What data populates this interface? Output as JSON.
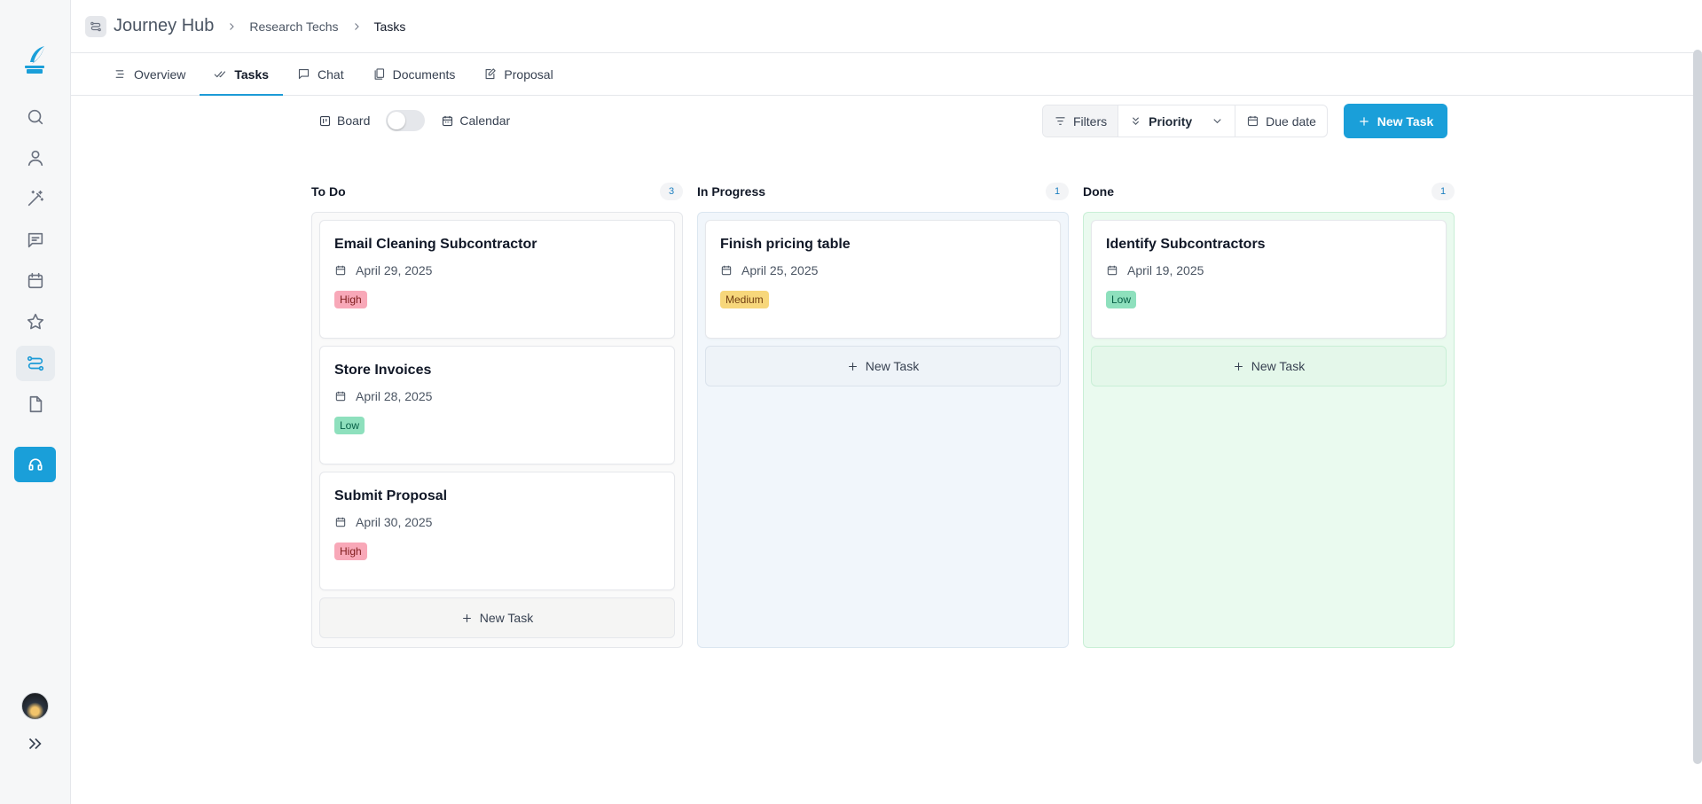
{
  "sidebar": {
    "items": [
      {
        "icon": "search-icon"
      },
      {
        "icon": "user-icon"
      },
      {
        "icon": "magic-wand-icon"
      },
      {
        "icon": "message-icon"
      },
      {
        "icon": "calendar-icon"
      },
      {
        "icon": "star-icon"
      },
      {
        "icon": "route-icon",
        "active": true
      },
      {
        "icon": "file-icon"
      }
    ],
    "support_icon": "headset-icon",
    "accent_color": "#1a9fd9"
  },
  "header": {
    "title": "Journey Hub",
    "breadcrumbs": [
      "Research Techs",
      "Tasks"
    ]
  },
  "tabs": [
    {
      "label": "Overview",
      "icon": "list-icon"
    },
    {
      "label": "Tasks",
      "icon": "check-double-icon",
      "active": true
    },
    {
      "label": "Chat",
      "icon": "chat-icon"
    },
    {
      "label": "Documents",
      "icon": "documents-icon"
    },
    {
      "label": "Proposal",
      "icon": "edit-icon"
    }
  ],
  "toolbar": {
    "board_label": "Board",
    "calendar_label": "Calendar",
    "filters_label": "Filters",
    "priority_label": "Priority",
    "due_date_label": "Due date",
    "new_task_label": "New Task"
  },
  "board": {
    "columns": [
      {
        "title": "To Do",
        "count": "3",
        "add_label": "New Task",
        "cards": [
          {
            "title": "Email Cleaning Subcontractor",
            "date": "April 29, 2025",
            "priority": "High"
          },
          {
            "title": "Store Invoices",
            "date": "April 28, 2025",
            "priority": "Low"
          },
          {
            "title": "Submit Proposal",
            "date": "April 30, 2025",
            "priority": "High"
          }
        ]
      },
      {
        "title": "In Progress",
        "count": "1",
        "add_label": "New Task",
        "cards": [
          {
            "title": "Finish pricing table",
            "date": "April 25, 2025",
            "priority": "Medium"
          }
        ]
      },
      {
        "title": "Done",
        "count": "1",
        "add_label": "New Task",
        "cards": [
          {
            "title": "Identify Subcontractors",
            "date": "April 19, 2025",
            "priority": "Low"
          }
        ]
      }
    ]
  }
}
